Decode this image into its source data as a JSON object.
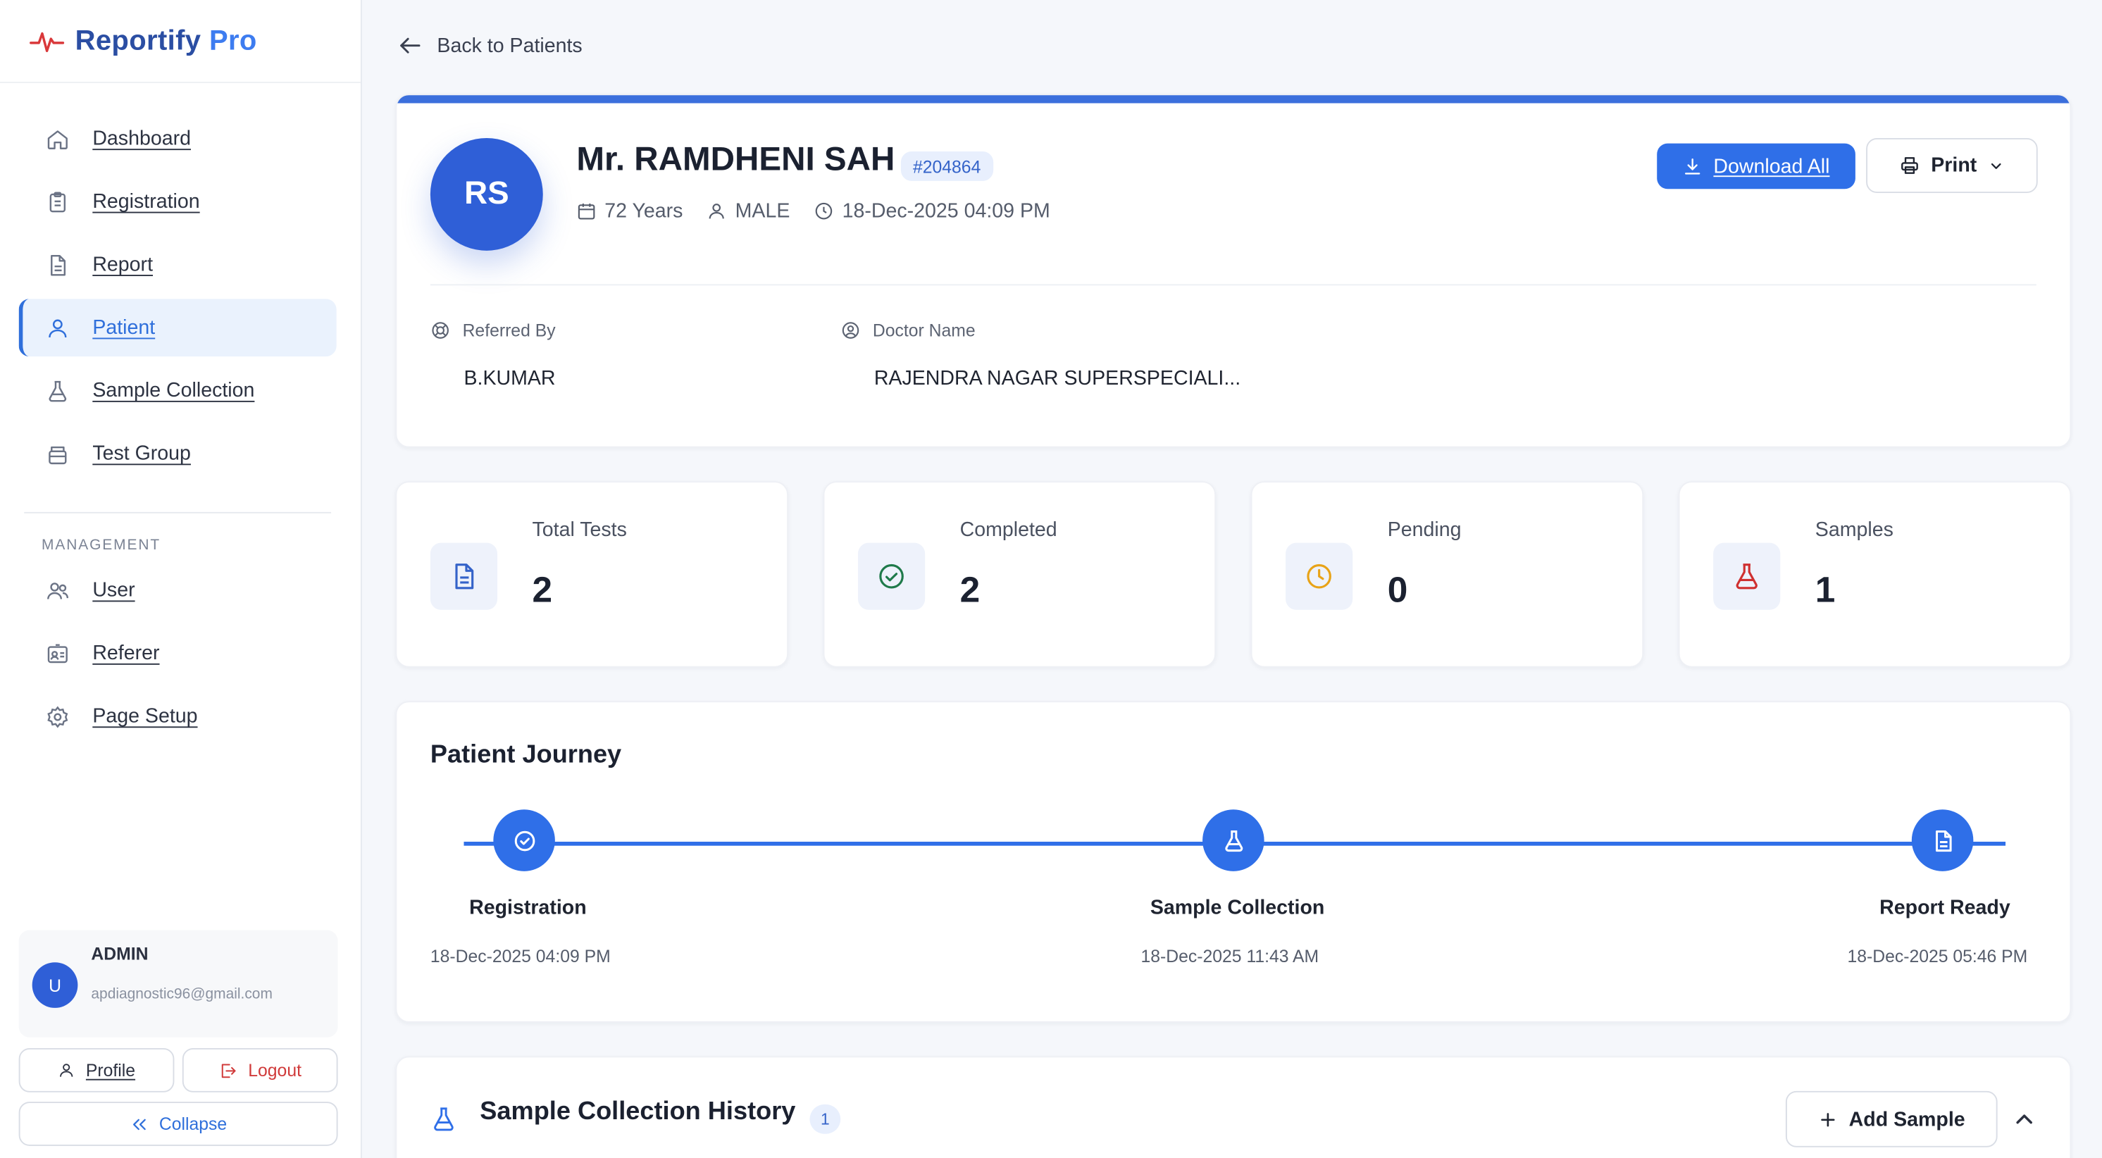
{
  "brand": {
    "name": "Reportify",
    "suffix": "Pro"
  },
  "nav": {
    "items": [
      {
        "label": "Dashboard",
        "icon": "home-icon"
      },
      {
        "label": "Registration",
        "icon": "clipboard-icon"
      },
      {
        "label": "Report",
        "icon": "file-icon"
      },
      {
        "label": "Patient",
        "icon": "user-icon",
        "active": true
      },
      {
        "label": "Sample Collection",
        "icon": "flask-icon"
      },
      {
        "label": "Test Group",
        "icon": "box-icon"
      }
    ],
    "section_title": "MANAGEMENT",
    "management": [
      {
        "label": "User",
        "icon": "users-icon"
      },
      {
        "label": "Referer",
        "icon": "id-card-icon"
      },
      {
        "label": "Page Setup",
        "icon": "gear-icon"
      }
    ]
  },
  "user": {
    "initial": "U",
    "name": "ADMIN",
    "email": "apdiagnostic96@gmail.com"
  },
  "sidebar_buttons": {
    "profile": "Profile",
    "logout": "Logout",
    "collapse": "Collapse"
  },
  "back_label": "Back to Patients",
  "patient": {
    "initials": "RS",
    "name": "Mr. RAMDHENI SAH",
    "id": "#204864",
    "age": "72 Years",
    "gender": "MALE",
    "registered": "18-Dec-2025 04:09 PM",
    "referred_by_label": "Referred By",
    "referred_by": "B.KUMAR",
    "doctor_label": "Doctor Name",
    "doctor": "RAJENDRA NAGAR SUPERSPECIALI..."
  },
  "actions": {
    "download_all": "Download All",
    "print": "Print"
  },
  "stats": [
    {
      "label": "Total Tests",
      "value": "2",
      "icon": "document-icon",
      "color": "#3463c9"
    },
    {
      "label": "Completed",
      "value": "2",
      "icon": "check-circle-icon",
      "color": "#1f7a4a"
    },
    {
      "label": "Pending",
      "value": "0",
      "icon": "clock-icon",
      "color": "#e8a317"
    },
    {
      "label": "Samples",
      "value": "1",
      "icon": "flask-icon",
      "color": "#cf3030"
    }
  ],
  "journey": {
    "title": "Patient Journey",
    "steps": [
      {
        "label": "Registration",
        "date": "18-Dec-2025 04:09 PM",
        "icon": "check-circle-icon"
      },
      {
        "label": "Sample Collection",
        "date": "18-Dec-2025 11:43 AM",
        "icon": "flask-icon"
      },
      {
        "label": "Report Ready",
        "date": "18-Dec-2025 05:46 PM",
        "icon": "document-icon"
      }
    ]
  },
  "history": {
    "title": "Sample Collection History",
    "count": "1",
    "add_label": "Add Sample"
  },
  "colors": {
    "accent": "#2f6fe8",
    "brand": "#2b4ea3",
    "danger": "#d03a3a"
  }
}
